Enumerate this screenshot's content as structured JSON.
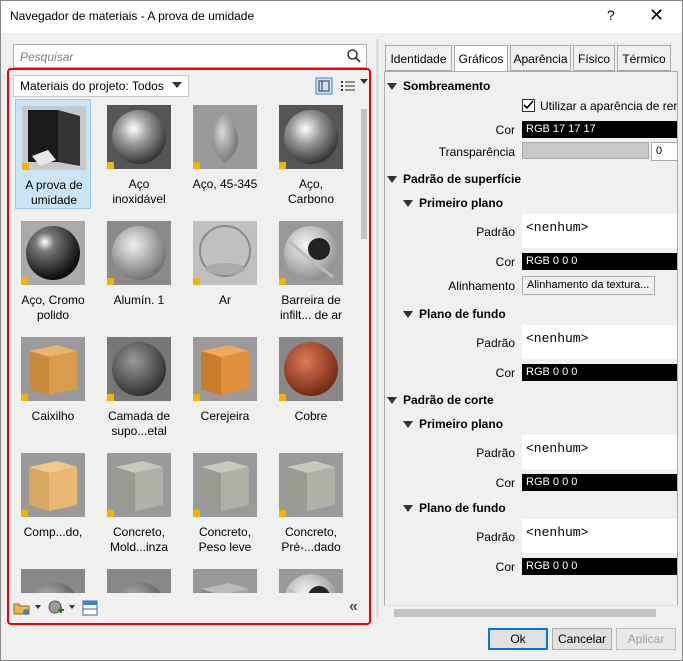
{
  "window": {
    "title": "Navegador de materiais - A prova de umidade",
    "help": "?",
    "close": "✕"
  },
  "search": {
    "placeholder": "Pesquisar"
  },
  "breadcrumb": {
    "label": "Materiais do projeto: Todos"
  },
  "materials": [
    {
      "label": "A prova de\numidade",
      "selected": true,
      "thumb": "dark-wall"
    },
    {
      "label": "Aço\ninoxidável",
      "thumb": "chrome-sphere"
    },
    {
      "label": "Aço, 45-345",
      "thumb": "grey-drop"
    },
    {
      "label": "Aço,\nCarbono",
      "thumb": "chrome-sphere"
    },
    {
      "label": "Aço, Cromo\npolido",
      "thumb": "black-chrome"
    },
    {
      "label": "Alumín. 1",
      "thumb": "silver-sphere"
    },
    {
      "label": "Ar",
      "thumb": "glass"
    },
    {
      "label": "Barreira de\ninfilt... de ar",
      "thumb": "tennis-ball"
    },
    {
      "label": "Caixilho",
      "thumb": "wood-cube"
    },
    {
      "label": "Camada de\nsupo...etal",
      "thumb": "stone-sphere"
    },
    {
      "label": "Cerejeira",
      "thumb": "wood-cube2"
    },
    {
      "label": "Cobre",
      "thumb": "copper-sphere"
    },
    {
      "label": "Comp...do,",
      "thumb": "wood-cube3"
    },
    {
      "label": "Concreto,\nMold...inza",
      "thumb": "concrete-cube"
    },
    {
      "label": "Concreto,\nPeso leve",
      "thumb": "concrete-cube"
    },
    {
      "label": "Concreto,\nPré-...dado",
      "thumb": "concrete-cube"
    },
    {
      "label": "",
      "thumb": "grey-sphere"
    },
    {
      "label": "",
      "thumb": "grey-sphere"
    },
    {
      "label": "",
      "thumb": "grey-cube"
    },
    {
      "label": "",
      "thumb": "tennis-ball"
    }
  ],
  "tabs": [
    {
      "label": "Identidade"
    },
    {
      "label": "Gráficos",
      "active": true
    },
    {
      "label": "Aparência"
    },
    {
      "label": "Físico"
    },
    {
      "label": "Térmico"
    }
  ],
  "graphics": {
    "shading": {
      "title": "Sombreamento",
      "use_render_appearance": "Utilizar a aparência de ren",
      "color_label": "Cor",
      "color_value": "RGB 17 17 17",
      "transparency_label": "Transparência",
      "transparency_value": "0"
    },
    "surface_pattern": {
      "title": "Padrão de superfície",
      "foreground": {
        "title": "Primeiro plano",
        "pattern_label": "Padrão",
        "pattern_value": "<nenhum>",
        "color_label": "Cor",
        "color_value": "RGB 0 0 0",
        "alignment_label": "Alinhamento",
        "alignment_value": "Alinhamento da textura..."
      },
      "background": {
        "title": "Plano de fundo",
        "pattern_label": "Padrão",
        "pattern_value": "<nenhum>",
        "color_label": "Cor",
        "color_value": "RGB 0 0 0"
      }
    },
    "cut_pattern": {
      "title": "Padrão de corte",
      "foreground": {
        "title": "Primeiro plano",
        "pattern_label": "Padrão",
        "pattern_value": "<nenhum>",
        "color_label": "Cor",
        "color_value": "RGB 0 0 0"
      },
      "background": {
        "title": "Plano de fundo",
        "pattern_label": "Padrão",
        "pattern_value": "<nenhum>",
        "color_label": "Cor",
        "color_value": "RGB 0 0 0"
      }
    }
  },
  "buttons": {
    "ok": "Ok",
    "cancel": "Cancelar",
    "apply": "Aplicar"
  },
  "colors": {
    "highlight": "#e8000b",
    "selection": "#cce4f7",
    "accent": "#0078d7"
  }
}
